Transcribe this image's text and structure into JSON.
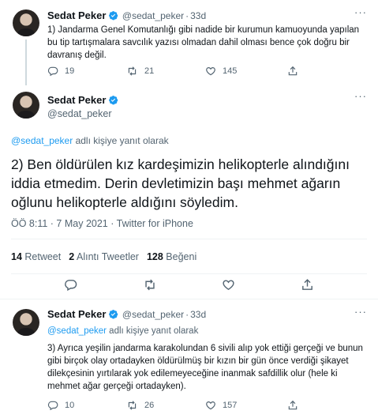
{
  "tweet1": {
    "name": "Sedat Peker",
    "handle": "@sedat_peker",
    "time": "33d",
    "text": "1) Jandarma Genel Komutanlığı gibi nadide bir kurumun kamuoyunda yapılan bu tip tartışmalara savcılık yazısı olmadan dahil olması bence çok doğru bir davranış değil.",
    "replies": "19",
    "retweets": "21",
    "likes": "145"
  },
  "main": {
    "name": "Sedat Peker",
    "handle": "@sedat_peker",
    "reply_link": "@sedat_peker",
    "reply_suffix": " adlı kişiye yanıt olarak",
    "text": "2) Ben öldürülen kız kardeşimizin helikopterle alındığını iddia etmedim. Derin devletimizin başı mehmet ağarın oğlunu helikopterle aldığını söyledim.",
    "meta": "ÖÖ 8:11 · 7 May 2021 · Twitter for iPhone",
    "retweet_count": "14",
    "retweet_label": " Retweet",
    "quote_count": "2",
    "quote_label": " Alıntı Tweetler",
    "like_count": "128",
    "like_label": " Beğeni"
  },
  "tweet3": {
    "name": "Sedat Peker",
    "handle": "@sedat_peker",
    "time": "33d",
    "reply_link": "@sedat_peker",
    "reply_suffix": " adlı kişiye yanıt olarak",
    "text": "3) Ayrıca yeşilin jandarma karakolundan 6 sivili alıp yok ettiği gerçeği ve bunun gibi birçok olay ortadayken öldürülmüş bir kızın bir gün önce verdiği şikayet dilekçesinin yırtılarak yok edilemeyeceğine inanmak safdillik olur (hele ki mehmet ağar gerçeği ortadayken).",
    "replies": "10",
    "retweets": "26",
    "likes": "157"
  },
  "colors": {
    "accent": "#1d9bf0",
    "text": "#0f1419",
    "muted": "#536471",
    "divider": "#eff3f4"
  }
}
